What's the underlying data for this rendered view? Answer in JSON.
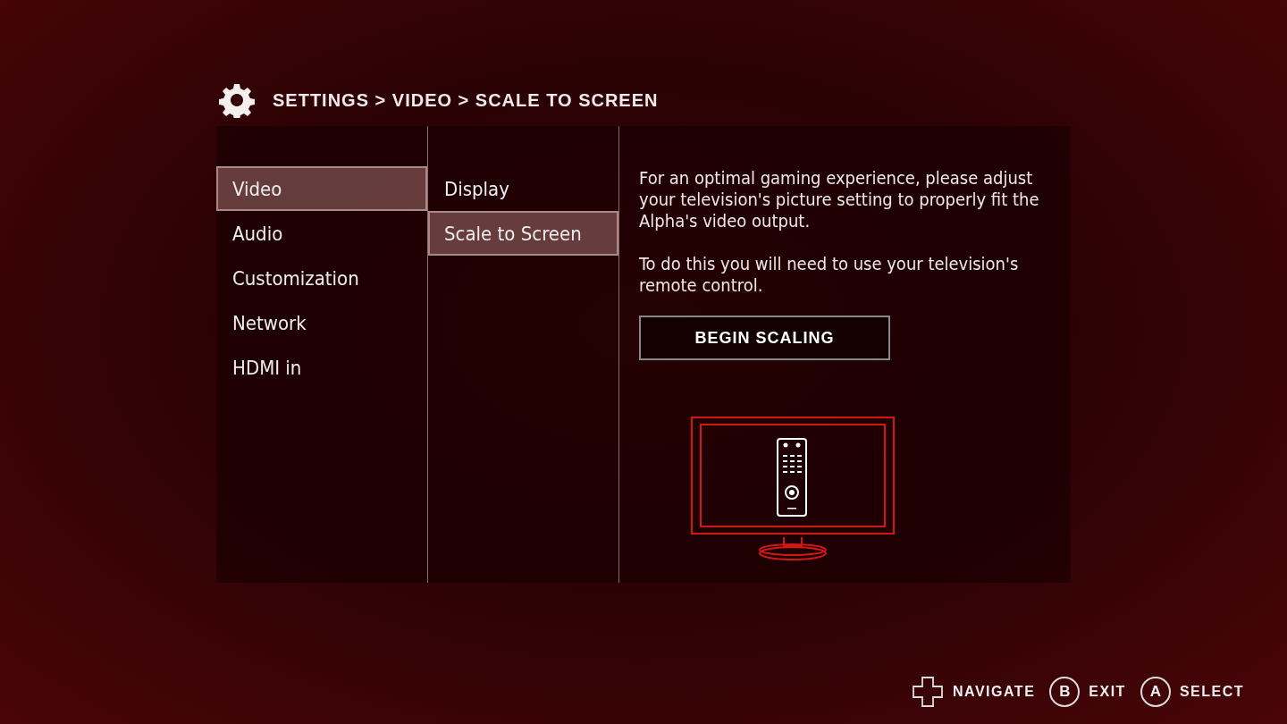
{
  "header": {
    "breadcrumb": "SETTINGS > VIDEO > SCALE TO SCREEN"
  },
  "categories": [
    {
      "label": "Video",
      "selected": true
    },
    {
      "label": "Audio",
      "selected": false
    },
    {
      "label": "Customization",
      "selected": false
    },
    {
      "label": "Network",
      "selected": false
    },
    {
      "label": "HDMI in",
      "selected": false
    }
  ],
  "subcategories": [
    {
      "label": "Display",
      "selected": false
    },
    {
      "label": "Scale to Screen",
      "selected": true
    }
  ],
  "detail": {
    "paragraphs": [
      "For an optimal gaming experience, please adjust your television's picture setting to properly fit the Alpha's video output.",
      "To do this you will need to use your television's remote control."
    ],
    "button": "BEGIN SCALING"
  },
  "footer": [
    {
      "kind": "dpad",
      "label": "NAVIGATE"
    },
    {
      "kind": "circle",
      "key": "B",
      "label": "EXIT"
    },
    {
      "kind": "circle",
      "key": "A",
      "label": "SELECT"
    }
  ]
}
